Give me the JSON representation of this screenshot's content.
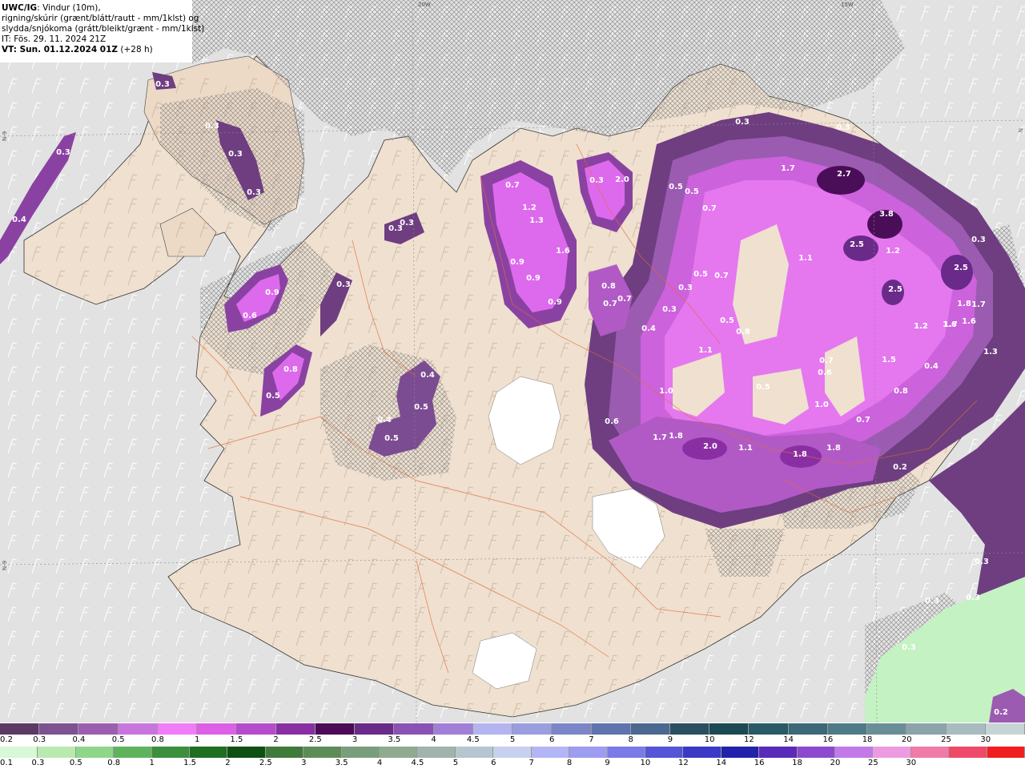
{
  "header": {
    "model": "UWC/IG",
    "line1_rest": ": Vindur (10m),",
    "line2": "rigning/skúrir (grænt/blátt/rautt - mm/1klst) og",
    "line3": "slydda/snjókoma (grátt/bleikt/grænt - mm/1klst)",
    "init_time": "IT: Fös. 29. 11. 2024 21Z",
    "valid_time": "VT: Sun. 01.12.2024 01Z",
    "lead": " (+28 h)"
  },
  "map_edges": {
    "lon_20w": "20W",
    "lon_15w": "15W",
    "lat_left": "N-9",
    "lat_right": "N",
    "lat_left_top": "N-9"
  },
  "precip_labels": [
    "0.3",
    "0.3",
    "0.3",
    "0.3",
    "0.3",
    "0.4",
    "0.3",
    "0.3",
    "0.9",
    "0.6",
    "0.3",
    "0.8",
    "0.5",
    "0.4",
    "0.5",
    "0.4",
    "0.5",
    "0.7",
    "1.2",
    "1.3",
    "1.6",
    "0.9",
    "0.9",
    "0.9",
    "2.0",
    "0.3",
    "0.5",
    "0.5",
    "0.7",
    "0.8",
    "0.7",
    "0.7",
    "0.3",
    "0.4",
    "0.5",
    "0.3",
    "0.5",
    "0.7",
    "0.8",
    "1.7",
    "2.7",
    "3.8",
    "2.5",
    "1.2",
    "2.5",
    "2.5",
    "0.3",
    "0.3",
    "1.1",
    "1.2",
    "1.1",
    "1.0",
    "0.5",
    "0.7",
    "0.6",
    "1.0",
    "1.8",
    "1.7",
    "1.6",
    "1.6",
    "1.7",
    "1.2",
    "1.3",
    "0.4",
    "1.5",
    "0.8",
    "0.7",
    "0.6",
    "1.7",
    "1.8",
    "2.0",
    "1.1",
    "1.8",
    "1.8",
    "0.2",
    "0.3",
    "0.3",
    "0.3",
    "0.3",
    "0.3",
    "0.2"
  ],
  "legend": {
    "snow_colors": [
      "#5b3a66",
      "#7e5190",
      "#9c5fb0",
      "#c875de",
      "#f07cf8",
      "#dc5fe6",
      "#b54ccc",
      "#8a2fa3",
      "#4d0a57",
      "#6a2a8a",
      "#8a52b2",
      "#a07fd6",
      "#b4b4f0",
      "#9a9ee0",
      "#7a86c8",
      "#5f73ad",
      "#4a6890",
      "#2a4f60",
      "#1c4a52",
      "#2a5a66",
      "#3c6878",
      "#4f7a88",
      "#6a8e98",
      "#8aa4aa",
      "#a8bcc0",
      "#c7d4d6"
    ],
    "snow_ticks": [
      "0.2",
      "0.3",
      "0.4",
      "0.5",
      "0.8",
      "1",
      "1.5",
      "2",
      "2.5",
      "3",
      "3.5",
      "4",
      "4.5",
      "5",
      "6",
      "7",
      "8",
      "9",
      "10",
      "12",
      "14",
      "16",
      "18",
      "20",
      "25",
      "30"
    ],
    "rain_colors": [
      "#d8f8d6",
      "#b8eab0",
      "#8fd68a",
      "#5fb35d",
      "#3c8f3c",
      "#1f6e22",
      "#0f4f14",
      "#3f7a3a",
      "#5e8c58",
      "#7a9e7c",
      "#8eaa90",
      "#a0b4ac",
      "#b6c6d0",
      "#c7d0ee",
      "#b2b6f4",
      "#9c9cf0",
      "#7a7ae8",
      "#5555d8",
      "#3a3ac6",
      "#2222aa",
      "#5a2ab8",
      "#8d4ad0",
      "#c27ae8",
      "#ee9ae0",
      "#f07aa8",
      "#f04a6a",
      "#f01e1e"
    ],
    "rain_ticks": [
      "0.1",
      "0.3",
      "0.5",
      "0.8",
      "1",
      "1.5",
      "2",
      "2.5",
      "3",
      "3.5",
      "4",
      "4.5",
      "5",
      "6",
      "7",
      "8",
      "9",
      "10",
      "12",
      "14",
      "16",
      "18",
      "20",
      "25",
      "30"
    ]
  }
}
